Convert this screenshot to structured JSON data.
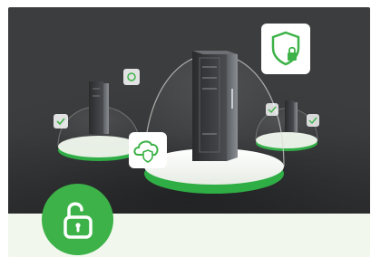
{
  "hero": {
    "description_icons": [
      "server-rack-icon",
      "shield-lock-icon",
      "cloud-shield-icon",
      "gear-icon",
      "checkmark-icon"
    ]
  },
  "badge": {
    "icon": "unlocked-padlock-icon"
  },
  "colors": {
    "accent_green": "#3db248",
    "hero_background": "#3a3b3d",
    "card_background": "#f2f7ee"
  }
}
